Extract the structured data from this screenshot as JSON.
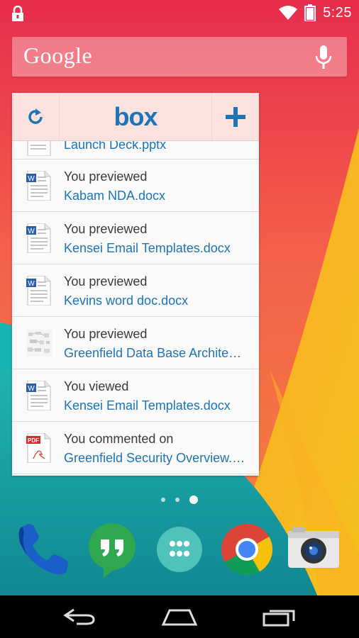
{
  "status_bar": {
    "time": "5:25",
    "icons": [
      "lock-icon",
      "wifi-icon",
      "battery-icon"
    ]
  },
  "search_bar": {
    "label": "Google",
    "mic_icon": "microphone-icon"
  },
  "box_widget": {
    "logo": "box",
    "refresh_icon": "refresh-icon",
    "add_icon": "plus-icon",
    "items": [
      {
        "action": "",
        "file": "Launch Deck.pptx",
        "icon": "doc"
      },
      {
        "action": "You previewed",
        "file": "Kabam NDA.docx",
        "icon": "doc"
      },
      {
        "action": "You previewed",
        "file": "Kensei Email Templates.docx",
        "icon": "doc"
      },
      {
        "action": "You previewed",
        "file": "Kevins word doc.docx",
        "icon": "doc"
      },
      {
        "action": "You previewed",
        "file": "Greenfield Data Base Archite…",
        "icon": "image"
      },
      {
        "action": "You viewed",
        "file": "Kensei Email Templates.docx",
        "icon": "doc"
      },
      {
        "action": "You commented on",
        "file": "Greenfield Security Overview.…",
        "icon": "pdf"
      }
    ],
    "pdf_badge": "PDF"
  },
  "page_indicator": {
    "count": 3,
    "active": 3
  },
  "dock": {
    "apps": [
      "phone",
      "hangouts",
      "app-drawer",
      "chrome",
      "camera"
    ]
  },
  "nav_bar": {
    "buttons": [
      "back",
      "home",
      "recents"
    ]
  },
  "colors": {
    "accent": "#1c74b9",
    "wallpaper_red": "#f3454b",
    "wallpaper_orange": "#f7941e",
    "wallpaper_teal": "#1cbfbb"
  }
}
